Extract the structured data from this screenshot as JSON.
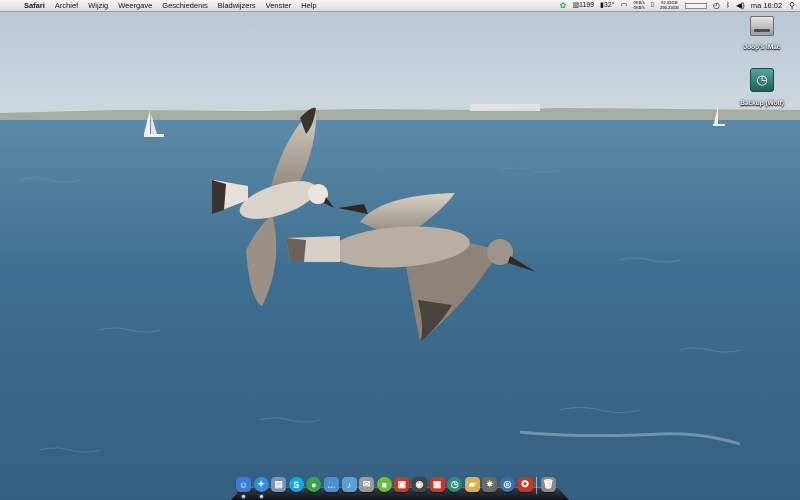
{
  "menubar": {
    "app_name": "Safari",
    "items": [
      "Archief",
      "Wijzig",
      "Weergave",
      "Geschiedenis",
      "Bladwijzers",
      "Venster",
      "Help"
    ],
    "status": {
      "counter": "1199",
      "temperature": "32°",
      "net_upper": "0KB/s",
      "net_lower": "0KB/s",
      "disk_upper": "62.55GB",
      "disk_lower": "295.23GB",
      "clock": "ma 16:02"
    }
  },
  "desktop_icons": [
    {
      "label": "Joop's iMac",
      "icon": "hard-drive-icon"
    },
    {
      "label": "Backup (Wolf)",
      "icon": "time-machine-icon"
    }
  ],
  "dock": {
    "apps": [
      {
        "name": "finder-icon",
        "glyph": "☺",
        "color": "#3a7bd5",
        "running": true
      },
      {
        "name": "safari-icon",
        "glyph": "✦",
        "color": "#2f8fd8",
        "running": true
      },
      {
        "name": "preview-icon",
        "glyph": "▤",
        "color": "#7a95b8",
        "running": false
      },
      {
        "name": "skype-icon",
        "glyph": "S",
        "color": "#14a6e6",
        "running": false
      },
      {
        "name": "messenger-icon",
        "glyph": "●",
        "color": "#3da14b",
        "running": false
      },
      {
        "name": "ichat-icon",
        "glyph": "…",
        "color": "#4a8fd4",
        "running": false
      },
      {
        "name": "itunes-icon",
        "glyph": "♪",
        "color": "#5b9fd4",
        "running": false
      },
      {
        "name": "mail-icon",
        "glyph": "✉",
        "color": "#9a9a9a",
        "running": false
      },
      {
        "name": "facetime-icon",
        "glyph": "■",
        "color": "#6cbf3a",
        "running": false
      },
      {
        "name": "photo-booth-icon",
        "glyph": "▣",
        "color": "#b5412d",
        "running": false
      },
      {
        "name": "dvd-player-icon",
        "glyph": "◉",
        "color": "#444444",
        "running": false
      },
      {
        "name": "photos-icon",
        "glyph": "▦",
        "color": "#c23b2a",
        "running": false
      },
      {
        "name": "time-machine-icon",
        "glyph": "◷",
        "color": "#2e8c7d",
        "running": false
      },
      {
        "name": "folder-icon",
        "glyph": "▰",
        "color": "#d9b34a",
        "running": false
      },
      {
        "name": "system-preferences-icon",
        "glyph": "✷",
        "color": "#6a6a6a",
        "running": false
      },
      {
        "name": "network-icon",
        "glyph": "◎",
        "color": "#3a6fb0",
        "running": false
      },
      {
        "name": "app-store-icon",
        "glyph": "✪",
        "color": "#c7371f",
        "running": false
      }
    ],
    "trash": {
      "name": "trash-icon",
      "glyph": "🗑",
      "color": "#8a8a8a"
    }
  }
}
